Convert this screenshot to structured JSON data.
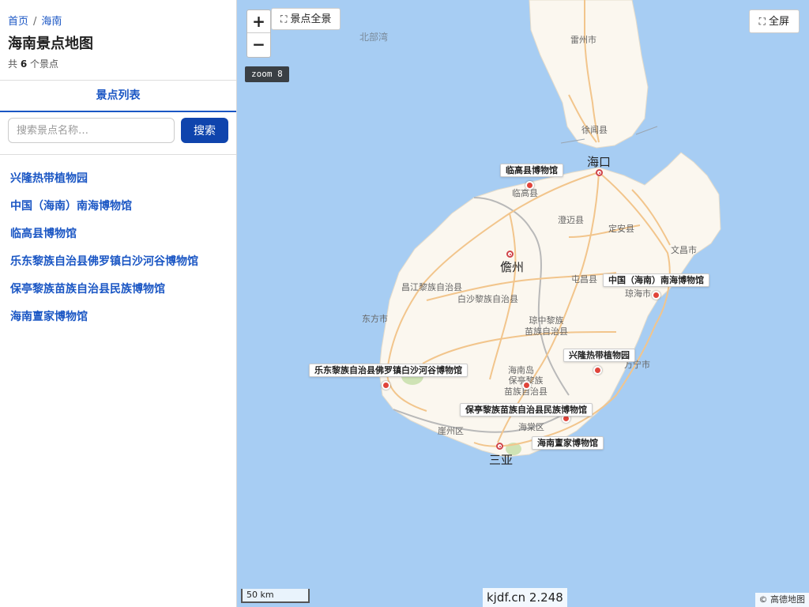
{
  "breadcrumb": {
    "home": "首页",
    "separator": "/",
    "current": "海南"
  },
  "page_title": "海南景点地图",
  "count": {
    "prefix": "共",
    "value": "6",
    "suffix": "个景点"
  },
  "tab_label": "景点列表",
  "search": {
    "placeholder": "搜索景点名称…",
    "value": "",
    "button": "搜索"
  },
  "spots": [
    "兴隆热带植物园",
    "中国（海南）南海博物馆",
    "临高县博物馆",
    "乐东黎族自治县佛罗镇白沙河谷博物馆",
    "保亭黎族苗族自治县民族博物馆",
    "海南亶家博物馆"
  ],
  "map": {
    "zoom_in": "+",
    "zoom_out": "−",
    "zoom_label": "zoom 8",
    "overview_button": "景点全景",
    "fullscreen_button": "全屏",
    "scale": "50 km",
    "site": "kjdf.cn 2.248",
    "copyright": "© 高德地图",
    "icons": {
      "expand": "expand-icon"
    },
    "colors": {
      "sea": "#a7cdf3",
      "land": "#fbf7ef",
      "marker": "#e0443a",
      "road": "#f2c58c",
      "accent": "#0f44ad"
    },
    "places": {
      "beibuwan": "北部湾",
      "leizhou": "雷州市",
      "xuwen": "徐闻县",
      "haikou": "海口",
      "lingao": "临高县",
      "chengmai": "澄迈县",
      "dingan": "定安县",
      "wenchang": "文昌市",
      "danzhou": "儋州",
      "tunchang": "屯昌县",
      "qionghai": "琼海市",
      "changjiang": "昌江黎族自治县",
      "baisha": "白沙黎族自治县",
      "dongfang": "东方市",
      "qiongzhong": "琼中黎族\n苗族自治县",
      "wanning": "万宁市",
      "hainandao": "海南岛",
      "baoting": "保亭黎族\n苗族自治县",
      "haitang": "海棠区",
      "yazhou": "崖州区",
      "sanya": "三亚"
    }
  }
}
